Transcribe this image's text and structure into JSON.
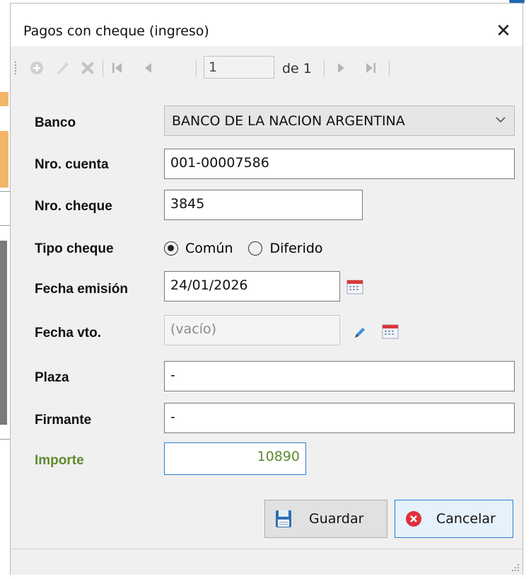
{
  "dialog": {
    "title": "Pagos con cheque (ingreso)",
    "close_label": "✕"
  },
  "toolbar": {
    "page_value": "1",
    "page_of": "de 1",
    "icons": [
      "add-icon",
      "edit-icon",
      "delete-icon",
      "first-page-icon",
      "prev-page-icon",
      "next-page-icon",
      "last-page-icon"
    ]
  },
  "form": {
    "banco": {
      "label": "Banco",
      "value": "BANCO DE LA NACION ARGENTINA"
    },
    "nro_cuenta": {
      "label": "Nro. cuenta",
      "value": "001-00007586"
    },
    "nro_cheque": {
      "label": "Nro. cheque",
      "value": "3845"
    },
    "tipo_cheque": {
      "label": "Tipo cheque",
      "options": [
        {
          "label": "Común",
          "checked": true
        },
        {
          "label": "Diferido",
          "checked": false
        }
      ]
    },
    "fecha_emision": {
      "label": "Fecha emisión",
      "value": "24/01/2026"
    },
    "fecha_vto": {
      "label": "Fecha vto.",
      "placeholder": "(vacío)"
    },
    "plaza": {
      "label": "Plaza",
      "value": "-"
    },
    "firmante": {
      "label": "Firmante",
      "value": "-"
    },
    "importe": {
      "label": "Importe",
      "value": "10890"
    }
  },
  "buttons": {
    "save_label": "Guardar",
    "cancel_label": "Cancelar"
  },
  "colors": {
    "accent_blue": "#2a7fd0",
    "importe_green": "#5f8a2e",
    "cancel_red": "#e0303a",
    "dialog_bg": "#f0f0f0"
  }
}
